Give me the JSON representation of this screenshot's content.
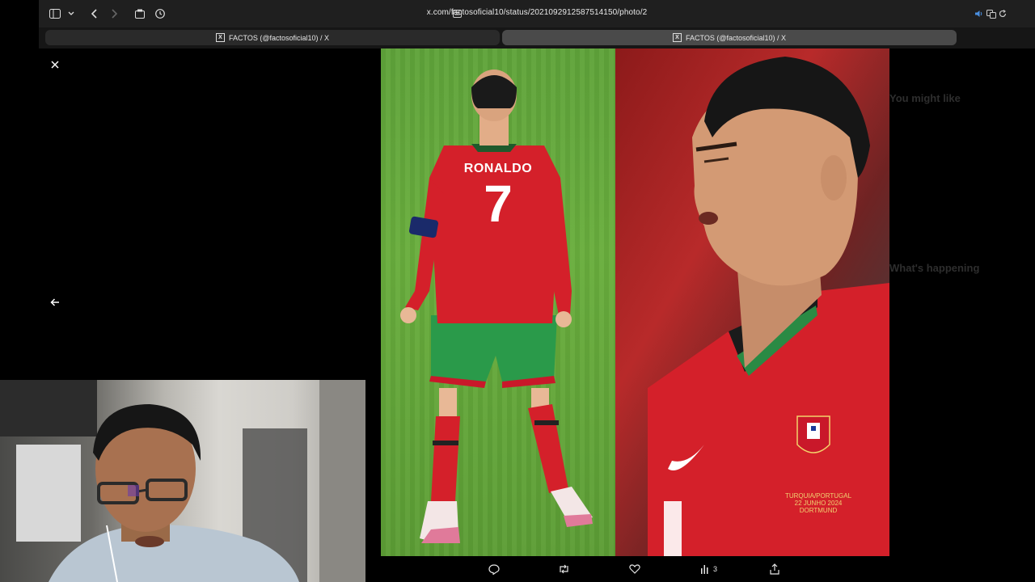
{
  "browser": {
    "url": "x.com/factosoficial10/status/2021092912587514150/photo/2",
    "tabs": [
      {
        "favicon": "X",
        "title": "FACTOS (@factosoficial10) / X"
      },
      {
        "favicon": "X",
        "title": "FACTOS (@factosoficial10) / X"
      }
    ]
  },
  "media": {
    "left_photo": {
      "name_on_jersey": "RONALDO",
      "number_on_jersey": "7"
    },
    "right_photo": {
      "badge_text_line1": "TURQUIA/PORTUGAL",
      "badge_text_line2": "22 JUNHO 2024",
      "badge_text_line3": "DORTMUND"
    }
  },
  "sidebar_dimmed": {
    "heading_1": "You might like",
    "heading_2": "What's happening"
  },
  "actions": {
    "views_count": "3"
  },
  "colors": {
    "browser_toolbar": "#1f1f1f",
    "active_tab": "#4a4a4a",
    "jersey_red": "#d4202a",
    "shorts_green": "#2a9a4a",
    "pitch_green": "#63a63a"
  },
  "icons": [
    "sidebar-icon",
    "chevron-down-icon",
    "back-arrow-icon",
    "forward-arrow-icon",
    "share-tab-icon",
    "history-icon",
    "reader-icon",
    "speaker-icon",
    "translate-icon",
    "reload-icon",
    "close-icon",
    "arrow-left-icon",
    "reply-icon",
    "repost-icon",
    "like-icon",
    "views-icon",
    "share-icon"
  ]
}
